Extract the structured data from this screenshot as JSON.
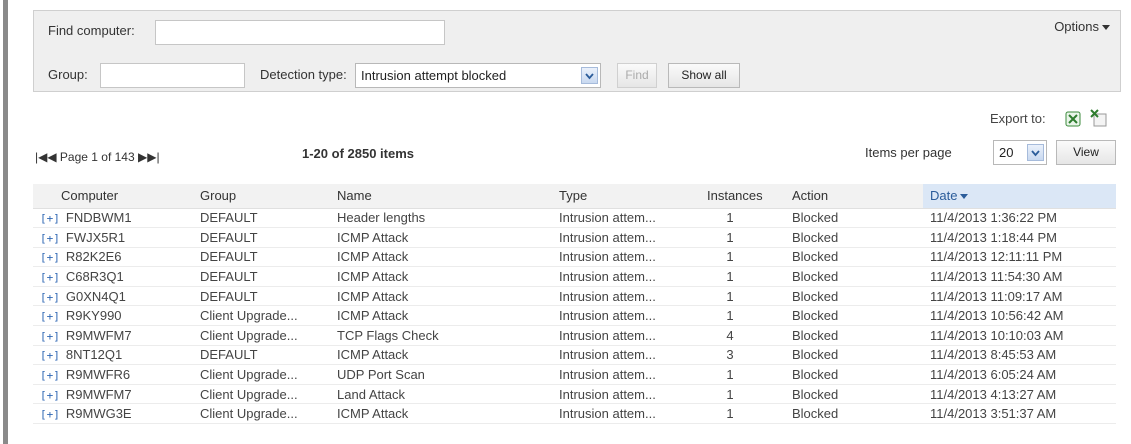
{
  "filter": {
    "find_computer_label": "Find computer:",
    "find_computer_value": "",
    "group_label": "Group:",
    "group_value": "",
    "detection_type_label": "Detection type:",
    "detection_type_value": "Intrusion attempt blocked",
    "find_button": "Find",
    "show_all_button": "Show all",
    "options_label": "Options"
  },
  "export": {
    "label": "Export to:"
  },
  "pager": {
    "text": "Page 1 of 143",
    "count": "1-20 of 2850 items"
  },
  "items_per_page": {
    "label": "Items per page",
    "value": "20",
    "view_button": "View"
  },
  "table": {
    "headers": [
      "Computer",
      "Group",
      "Name",
      "Type",
      "Instances",
      "Action",
      "Date"
    ],
    "rows": [
      [
        "FNDBWM1",
        "DEFAULT",
        "Header lengths",
        "Intrusion attem...",
        "1",
        "Blocked",
        "11/4/2013 1:36:22 PM"
      ],
      [
        "FWJX5R1",
        "DEFAULT",
        "ICMP Attack",
        "Intrusion attem...",
        "1",
        "Blocked",
        "11/4/2013 1:18:44 PM"
      ],
      [
        "R82K2E6",
        "DEFAULT",
        "ICMP Attack",
        "Intrusion attem...",
        "1",
        "Blocked",
        "11/4/2013 12:11:11 PM"
      ],
      [
        "C68R3Q1",
        "DEFAULT",
        "ICMP Attack",
        "Intrusion attem...",
        "1",
        "Blocked",
        "11/4/2013 11:54:30 AM"
      ],
      [
        "G0XN4Q1",
        "DEFAULT",
        "ICMP Attack",
        "Intrusion attem...",
        "1",
        "Blocked",
        "11/4/2013 11:09:17 AM"
      ],
      [
        "R9KY990",
        "Client Upgrade...",
        "ICMP Attack",
        "Intrusion attem...",
        "1",
        "Blocked",
        "11/4/2013 10:56:42 AM"
      ],
      [
        "R9MWFM7",
        "Client Upgrade...",
        "TCP Flags Check",
        "Intrusion attem...",
        "4",
        "Blocked",
        "11/4/2013 10:10:03 AM"
      ],
      [
        "8NT12Q1",
        "DEFAULT",
        "ICMP Attack",
        "Intrusion attem...",
        "3",
        "Blocked",
        "11/4/2013 8:45:53 AM"
      ],
      [
        "R9MWFR6",
        "Client Upgrade...",
        "UDP Port Scan",
        "Intrusion attem...",
        "1",
        "Blocked",
        "11/4/2013 6:05:24 AM"
      ],
      [
        "R9MWFM7",
        "Client Upgrade...",
        "Land Attack",
        "Intrusion attem...",
        "1",
        "Blocked",
        "11/4/2013 4:13:27 AM"
      ],
      [
        "R9MWG3E",
        "Client Upgrade...",
        "ICMP Attack",
        "Intrusion attem...",
        "1",
        "Blocked",
        "11/4/2013 3:51:37 AM"
      ]
    ]
  },
  "colors": {
    "accent": "#2e66b3",
    "panel": "#efefef",
    "sorted_header": "#dbe7f6"
  }
}
